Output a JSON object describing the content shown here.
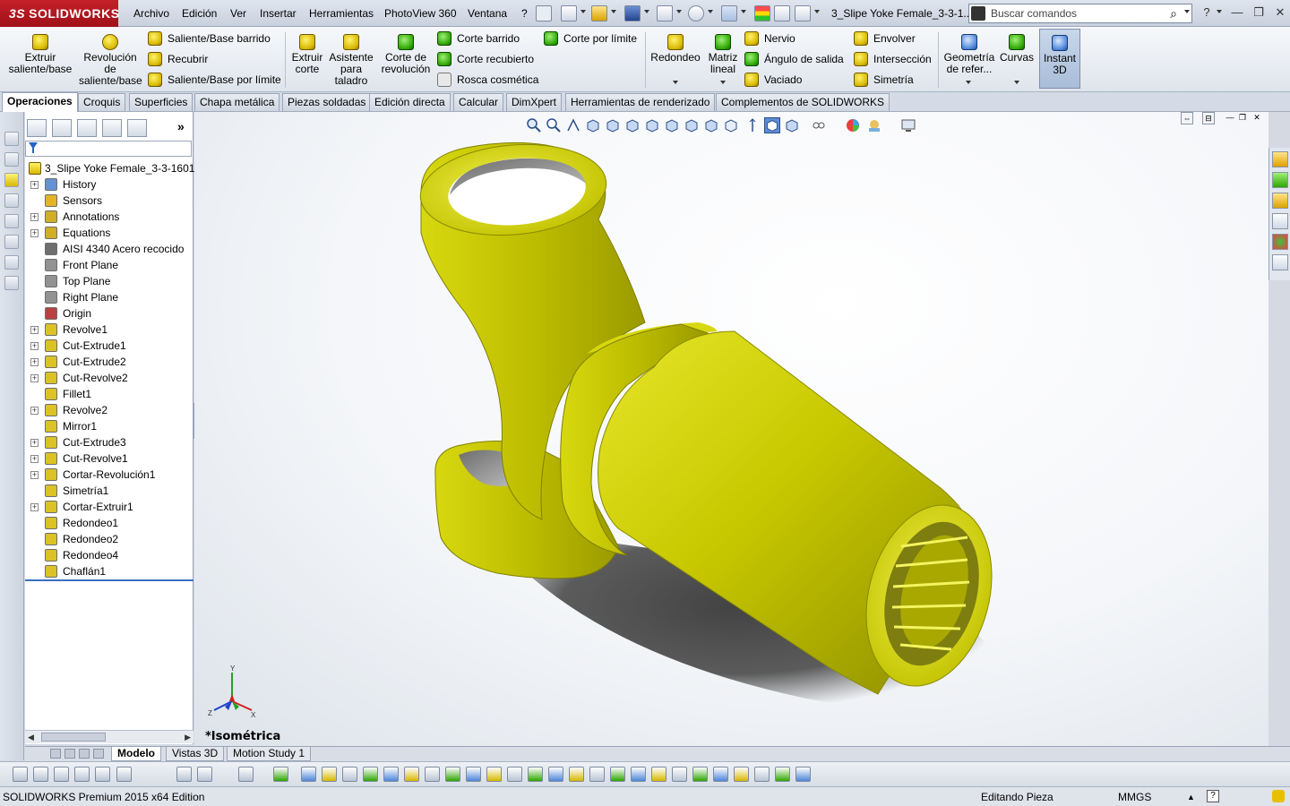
{
  "app": {
    "logo_prefix": "3S",
    "logo_text": "SOLIDWORKS",
    "doc_title": "3_Slipe Yoke Female_3-3-1...",
    "search_placeholder": "Buscar comandos"
  },
  "menu": [
    "Archivo",
    "Edición",
    "Ver",
    "Insertar",
    "Herramientas",
    "PhotoView 360",
    "Ventana",
    "?"
  ],
  "ribbon": {
    "extrude_boss": "Extruir saliente/base",
    "revolve_boss": "Revolución de saliente/base",
    "swept_boss": "Saliente/Base barrido",
    "lofted_boss": "Recubrir",
    "boundary_boss": "Saliente/Base por límite",
    "extrude_cut": "Extruir corte",
    "hole_wizard": "Asistente para taladro",
    "revolve_cut": "Corte de revolución",
    "swept_cut": "Corte barrido",
    "lofted_cut": "Corte recubierto",
    "cosmetic_thread": "Rosca cosmética",
    "boundary_cut": "Corte por límite",
    "fillet": "Redondeo",
    "linear_pattern": "Matriz lineal",
    "rib": "Nervio",
    "draft": "Ángulo de salida",
    "shell": "Vaciado",
    "wrap": "Envolver",
    "intersect": "Intersección",
    "mirror": "Simetría",
    "ref_geometry": "Geometría de refer...",
    "curves": "Curvas",
    "instant3d": "Instant 3D"
  },
  "tabs": [
    "Operaciones",
    "Croquis",
    "Superficies",
    "Chapa metálica",
    "Piezas soldadas",
    "Edición directa",
    "Calcular",
    "DimXpert",
    "Herramientas de renderizado",
    "Complementos de SOLIDWORKS"
  ],
  "tree": {
    "root": "3_Slipe Yoke Female_3-3-1601K",
    "items": [
      {
        "label": "History",
        "icon": "history-icon",
        "color": "#4a7fd0",
        "expand": true
      },
      {
        "label": "Sensors",
        "icon": "sensors-icon",
        "color": "#e0a800",
        "expand": false
      },
      {
        "label": "Annotations",
        "icon": "annotations-icon",
        "color": "#c9a000",
        "expand": true
      },
      {
        "label": "Equations",
        "icon": "equations-icon",
        "color": "#c9a000",
        "expand": true
      },
      {
        "label": "AISI 4340 Acero recocido",
        "icon": "material-icon",
        "color": "#555555",
        "expand": false
      },
      {
        "label": "Front Plane",
        "icon": "plane-icon",
        "color": "#808080",
        "expand": false
      },
      {
        "label": "Top Plane",
        "icon": "plane-icon",
        "color": "#808080",
        "expand": false
      },
      {
        "label": "Right Plane",
        "icon": "plane-icon",
        "color": "#808080",
        "expand": false
      },
      {
        "label": "Origin",
        "icon": "origin-icon",
        "color": "#b02020",
        "expand": false
      },
      {
        "label": "Revolve1",
        "icon": "revolve-icon",
        "color": "#d8b800",
        "expand": true
      },
      {
        "label": "Cut-Extrude1",
        "icon": "cut-extrude-icon",
        "color": "#d8b800",
        "expand": true
      },
      {
        "label": "Cut-Extrude2",
        "icon": "cut-extrude-icon",
        "color": "#d8b800",
        "expand": true
      },
      {
        "label": "Cut-Revolve2",
        "icon": "cut-revolve-icon",
        "color": "#d8b800",
        "expand": true
      },
      {
        "label": "Fillet1",
        "icon": "fillet-icon",
        "color": "#d8b800",
        "expand": false
      },
      {
        "label": "Revolve2",
        "icon": "revolve-icon",
        "color": "#d8b800",
        "expand": true
      },
      {
        "label": "Mirror1",
        "icon": "mirror-icon",
        "color": "#d8b800",
        "expand": false
      },
      {
        "label": "Cut-Extrude3",
        "icon": "cut-extrude-icon",
        "color": "#d8b800",
        "expand": true
      },
      {
        "label": "Cut-Revolve1",
        "icon": "cut-revolve-icon",
        "color": "#d8b800",
        "expand": true
      },
      {
        "label": "Cortar-Revolución1",
        "icon": "cut-revolve-icon",
        "color": "#d8b800",
        "expand": true
      },
      {
        "label": "Simetría1",
        "icon": "mirror-icon",
        "color": "#d8b800",
        "expand": false
      },
      {
        "label": "Cortar-Extruir1",
        "icon": "cut-extrude-icon",
        "color": "#d8b800",
        "expand": true
      },
      {
        "label": "Redondeo1",
        "icon": "fillet-icon",
        "color": "#d8b800",
        "expand": false
      },
      {
        "label": "Redondeo2",
        "icon": "fillet-icon",
        "color": "#d8b800",
        "expand": false
      },
      {
        "label": "Redondeo4",
        "icon": "fillet-icon",
        "color": "#d8b800",
        "expand": false
      },
      {
        "label": "Chaflán1",
        "icon": "chamfer-icon",
        "color": "#d8b800",
        "expand": false
      }
    ]
  },
  "viewport": {
    "view_label": "*Isométrica",
    "model_color": "#c8c800",
    "triad": {
      "x": "X",
      "y": "Y",
      "z": "Z"
    }
  },
  "bottom_tabs": [
    "Modelo",
    "Vistas 3D",
    "Motion Study 1"
  ],
  "status": {
    "edition": "SOLIDWORKS Premium 2015 x64 Edition",
    "mode": "Editando Pieza",
    "units": "MMGS"
  }
}
